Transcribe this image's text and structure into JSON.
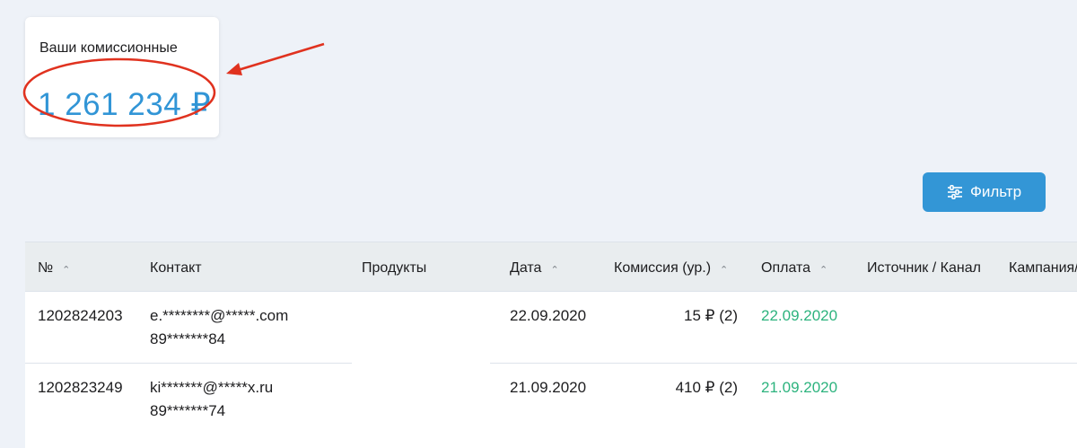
{
  "commission_card": {
    "label": "Ваши комиссионные",
    "amount": "1 261 234 ₽"
  },
  "annotation": {
    "color": "#e0321f"
  },
  "filter_button": {
    "label": "Фильтр",
    "icon": "sliders-icon",
    "color": "#3396d6"
  },
  "table": {
    "columns": [
      {
        "label": "№",
        "sortable": true
      },
      {
        "label": "Контакт",
        "sortable": false
      },
      {
        "label": "Продукты",
        "sortable": false
      },
      {
        "label": "Дата",
        "sortable": true
      },
      {
        "label": "Комиссия (ур.)",
        "sortable": true
      },
      {
        "label": "Оплата",
        "sortable": true
      },
      {
        "label": "Источник / Канал",
        "sortable": false
      },
      {
        "label": "Кампания/",
        "sortable": false
      }
    ],
    "sort_icon": "chevron-up-icon",
    "rows": [
      {
        "id": "1202824203",
        "contact_email": "e.********@*****.com",
        "contact_phone": "89*******84",
        "products": "",
        "date": "22.09.2020",
        "commission": "15 ₽ (2)",
        "payment": "22.09.2020",
        "source": "",
        "campaign": ""
      },
      {
        "id": "1202823249",
        "contact_email": "ki*******@*****x.ru",
        "contact_phone": "89*******74",
        "products": "",
        "date": "21.09.2020",
        "commission": "410 ₽ (2)",
        "payment": "21.09.2020",
        "source": "",
        "campaign": ""
      }
    ]
  },
  "colors": {
    "background": "#eef2f8",
    "accent": "#3195d6",
    "paid": "#2db37e"
  }
}
